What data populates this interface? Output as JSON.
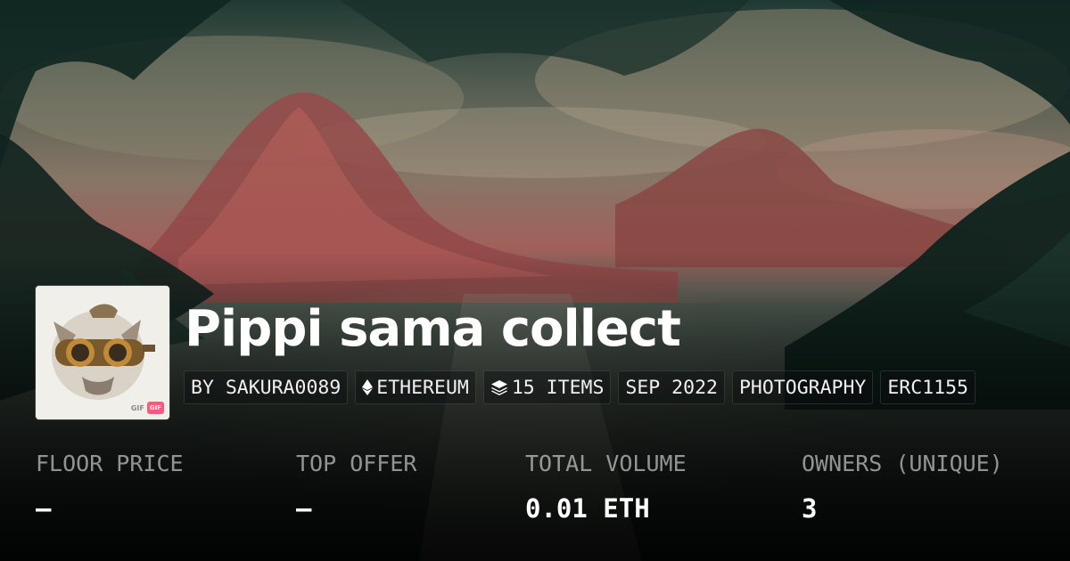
{
  "collection": {
    "name": "Pippi sama collect",
    "avatar_badge": {
      "label": "GIF",
      "pill": "GIF"
    }
  },
  "tags": [
    {
      "label": "BY SAKURA0089",
      "icon": null
    },
    {
      "label": "ETHEREUM",
      "icon": "ethereum-icon"
    },
    {
      "label": "15 ITEMS",
      "icon": "layers-icon"
    },
    {
      "label": "SEP 2022",
      "icon": null
    },
    {
      "label": "PHOTOGRAPHY",
      "icon": null
    },
    {
      "label": "ERC1155",
      "icon": null
    }
  ],
  "stats": [
    {
      "label": "FLOOR PRICE",
      "value": "—"
    },
    {
      "label": "TOP OFFER",
      "value": "—"
    },
    {
      "label": "TOTAL VOLUME",
      "value": "0.01 ETH"
    },
    {
      "label": "OWNERS (UNIQUE)",
      "value": "3"
    }
  ],
  "colors": {
    "text": "#ffffff",
    "muted_text": "#8c8c8c",
    "gif_badge": "#ff5a7a"
  }
}
